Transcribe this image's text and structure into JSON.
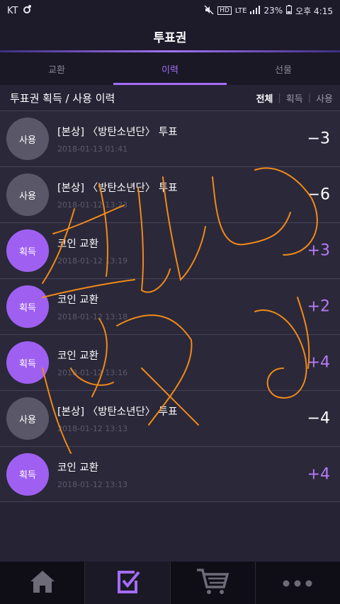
{
  "status": {
    "carrier": "KT",
    "battery": "23%",
    "time": "오후 4:15",
    "network": "LTE",
    "hd": "HD"
  },
  "header": {
    "title": "투표권"
  },
  "tabs": [
    {
      "label": "교환",
      "active": false
    },
    {
      "label": "이력",
      "active": true
    },
    {
      "label": "선물",
      "active": false
    }
  ],
  "section": {
    "title": "투표권 획득 / 사용 이력",
    "filters": [
      {
        "label": "전체",
        "active": true
      },
      {
        "label": "획득",
        "active": false
      },
      {
        "label": "사용",
        "active": false
      }
    ]
  },
  "history": [
    {
      "badge": "사용",
      "kind": "use",
      "title": "[본상] 〈방탄소년단〉 투표",
      "date": "2018-01-13 01:41",
      "amount": "−3"
    },
    {
      "badge": "사용",
      "kind": "use",
      "title": "[본상] 〈방탄소년단〉 투표",
      "date": "2018-01-12 13:23",
      "amount": "−6"
    },
    {
      "badge": "획득",
      "kind": "earn",
      "title": "코인 교환",
      "date": "2018-01-12 13:19",
      "amount": "+3"
    },
    {
      "badge": "획득",
      "kind": "earn",
      "title": "코인 교환",
      "date": "2018-01-12 13:18",
      "amount": "+2"
    },
    {
      "badge": "획득",
      "kind": "earn",
      "title": "코인 교환",
      "date": "2018-01-12 13:16",
      "amount": "+4"
    },
    {
      "badge": "사용",
      "kind": "use",
      "title": "[본상] 〈방탄소년단〉 투표",
      "date": "2018-01-12 13:13",
      "amount": "−4"
    },
    {
      "badge": "획득",
      "kind": "earn",
      "title": "코인 교환",
      "date": "2018-01-12 13:13",
      "amount": "+4"
    }
  ],
  "nav": [
    {
      "icon": "home-icon",
      "active": false
    },
    {
      "icon": "vote-check-icon",
      "active": true
    },
    {
      "icon": "cart-icon",
      "active": false
    },
    {
      "icon": "more-icon",
      "active": false
    }
  ],
  "colors": {
    "accent": "#a56cf7",
    "earn_badge": "#9f60f2",
    "use_badge": "#5a5868",
    "background": "#262335"
  }
}
